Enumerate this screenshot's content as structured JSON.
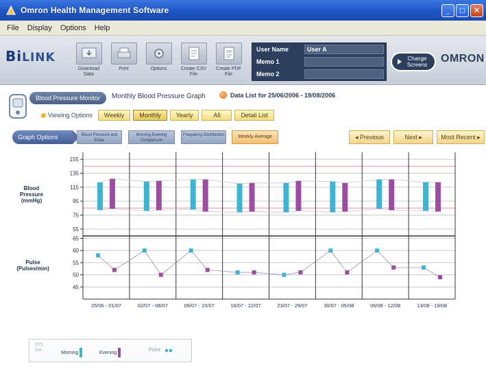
{
  "window": {
    "title": "Omron Health Management Software",
    "controls": [
      "_",
      "□",
      "✕"
    ]
  },
  "menu": [
    "File",
    "Display",
    "Options",
    "Help"
  ],
  "toolbar": {
    "logo_bi": "Bi",
    "logo_link": "LINK",
    "buttons": [
      {
        "label": "Download Data",
        "icon": "download-icon"
      },
      {
        "label": "Print",
        "icon": "print-icon"
      },
      {
        "label": "Options",
        "icon": "options-icon"
      },
      {
        "label": "Create CSV File",
        "icon": "create-csv-icon"
      },
      {
        "label": "Create PDF File",
        "icon": "create-pdf-icon"
      }
    ],
    "user": {
      "name_label": "User Name",
      "name_value": "User A",
      "memo1_label": "Memo 1",
      "memo1_value": "",
      "memo2_label": "Memo 2",
      "memo2_value": ""
    },
    "change_screens": "Change Screens",
    "brand": "OMRON"
  },
  "nav": {
    "device_tab": "Blood Pressure Monitor",
    "graph_title": "Monthly Blood Pressure Graph",
    "data_list": "Data List for 25/06/2006 - 19/08/2006",
    "viewing_options_label": "Viewing Options",
    "view_buttons": [
      "Weekly",
      "Monthly",
      "Yearly",
      "All",
      "Detail List"
    ],
    "active_view": "Monthly"
  },
  "graph_options": {
    "label": "Graph Options",
    "buttons": [
      "Blood Pressure and Pulse",
      "Morning Evening Comparison",
      "Frequency Distribution"
    ],
    "average_button": "Weekly Average",
    "previous": "◂ Previous",
    "next": "Next ▸",
    "most_recent": "Most Recent ▸"
  },
  "colors": {
    "morning": "#3fb4d2",
    "evening": "#9b4ea1",
    "pulse_morning": "#3fb4d2",
    "pulse_evening": "#9b4ea1",
    "guide": "#f2b3bd",
    "grid": "#c9c9c9",
    "frame": "#333333"
  },
  "chart_data": {
    "type": "bar",
    "categories": [
      "25/06 - 01/07",
      "02/07 - 08/07",
      "09/07 - 15/07",
      "16/07 - 22/07",
      "23/07 - 29/07",
      "30/07 - 05/08",
      "06/08 - 12/08",
      "13/08 - 19/08"
    ],
    "bp": {
      "ylabel": "Blood Pressure (mmHg)",
      "ticks": [
        155,
        135,
        115,
        95,
        75,
        55
      ],
      "ylim": [
        45,
        165
      ],
      "guides": [
        145,
        85
      ],
      "series": [
        {
          "name": "Morning",
          "ranges": [
            [
              82,
              122
            ],
            [
              81,
              123
            ],
            [
              83,
              126
            ],
            [
              79,
              120
            ],
            [
              79,
              121
            ],
            [
              79,
              123
            ],
            [
              84,
              126
            ],
            [
              81,
              122
            ]
          ]
        },
        {
          "name": "Evening",
          "ranges": [
            [
              84,
              127
            ],
            [
              82,
              124
            ],
            [
              80,
              126
            ],
            [
              80,
              121
            ],
            [
              81,
              124
            ],
            [
              80,
              121
            ],
            [
              82,
              126
            ],
            [
              80,
              122
            ]
          ]
        }
      ]
    },
    "pulse": {
      "ylabel": "Pulse (Pulses/min)",
      "ticks": [
        65,
        60,
        55,
        50,
        45
      ],
      "ylim": [
        40,
        66
      ],
      "series": [
        {
          "name": "Morning",
          "values": [
            58,
            60,
            60,
            51,
            50,
            60,
            60,
            53
          ]
        },
        {
          "name": "Evening",
          "values": [
            52,
            50,
            52,
            51,
            51,
            51,
            53,
            49
          ]
        }
      ]
    }
  },
  "legend": {
    "sys_dia": "SYS DIA",
    "morning": "Morning",
    "evening": "Evening",
    "pulse": "Pulse"
  }
}
